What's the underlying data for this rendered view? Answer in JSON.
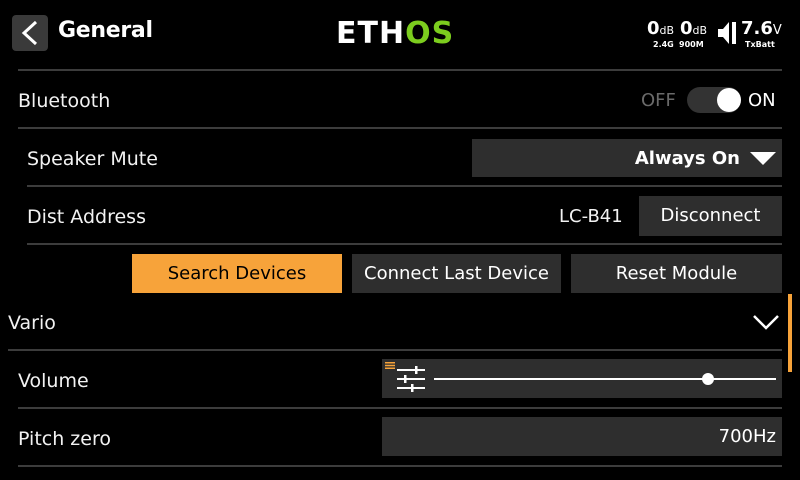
{
  "header": {
    "title": "General",
    "logo_left": "ETH",
    "logo_right": "OS",
    "rssi_1": {
      "value": "0",
      "unit": "dB",
      "label": "2.4G"
    },
    "rssi_2": {
      "value": "0",
      "unit": "dB",
      "label": "900M"
    },
    "battery": {
      "value": "7.6",
      "unit": "V",
      "label": "TxBatt"
    }
  },
  "bluetooth": {
    "label": "Bluetooth",
    "toggle_off": "OFF",
    "toggle_on": "ON",
    "state": true
  },
  "speaker_mute": {
    "label": "Speaker Mute",
    "value": "Always On"
  },
  "dist_address": {
    "label": "Dist Address",
    "value": "LC-B41",
    "button": "Disconnect"
  },
  "actions": {
    "search": "Search Devices",
    "connect_last": "Connect Last Device",
    "reset": "Reset Module"
  },
  "vario": {
    "label": "Vario",
    "volume": {
      "label": "Volume",
      "level": 0.8
    },
    "pitch_zero": {
      "label": "Pitch zero",
      "value": "700Hz"
    }
  },
  "colors": {
    "accent": "#f7a33a",
    "logo_green": "#7ccd1e",
    "field_bg": "#2e2e2e",
    "separator": "#3c3c3c"
  },
  "icons": [
    "back-arrow-icon",
    "speaker-icon",
    "dropdown-triangle-icon",
    "chevron-down-icon",
    "sliders-icon"
  ]
}
